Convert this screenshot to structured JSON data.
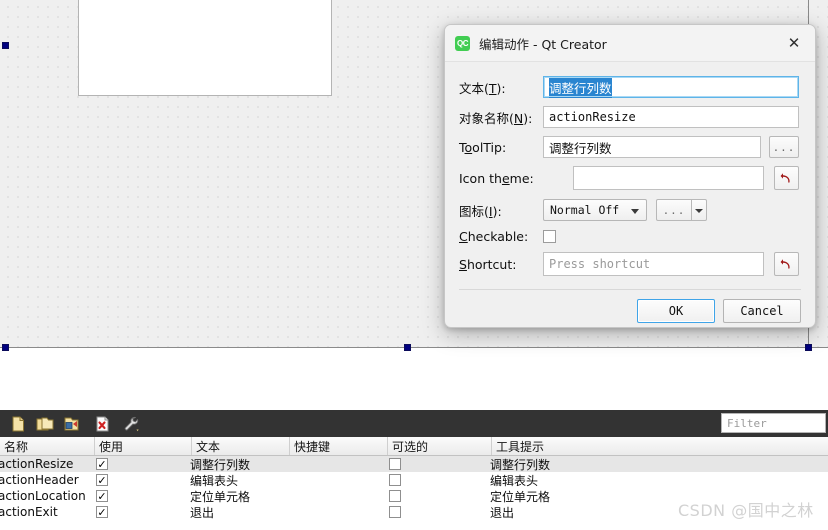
{
  "designer": {
    "widget_name": "form-widget",
    "selection_handles": 7
  },
  "dialog": {
    "title": "编辑动作 - Qt Creator",
    "app_icon_label": "QC",
    "close_label": "✕",
    "fields": {
      "text": {
        "label_prefix": "文本(",
        "label_mnemonic": "T",
        "label_suffix": "):",
        "value": "调整行列数"
      },
      "object_name": {
        "label_prefix": "对象名称(",
        "label_mnemonic": "N",
        "label_suffix": "):",
        "value": "actionResize"
      },
      "tooltip": {
        "label_pre": "T",
        "label_mnemonic": "o",
        "label_post": "olTip:",
        "value": "调整行列数",
        "browse_label": "..."
      },
      "icon_theme": {
        "label_pre": "Icon th",
        "label_mnemonic": "e",
        "label_post": "me:",
        "value": "",
        "revert_title": "revert"
      },
      "icon": {
        "label_prefix": "图标(",
        "label_mnemonic": "I",
        "label_suffix": "):",
        "combo_value": "Normal Off",
        "browse_label": "..."
      },
      "checkable": {
        "label_mnemonic": "C",
        "label_post": "heckable:",
        "checked": false
      },
      "shortcut": {
        "label_mnemonic": "S",
        "label_post": "hortcut:",
        "placeholder": "Press shortcut",
        "value": "",
        "revert_title": "revert"
      }
    },
    "buttons": {
      "ok": "OK",
      "cancel": "Cancel"
    }
  },
  "action_editor": {
    "toolbar_icons": [
      "new-action-icon",
      "copy-icon",
      "edit-icon",
      "delete-icon",
      "tools-icon"
    ],
    "filter": {
      "placeholder": "Filter",
      "value": ""
    },
    "columns": [
      "名称",
      "使用",
      "文本",
      "快捷键",
      "可选的",
      "工具提示"
    ],
    "rows": [
      {
        "name": "actionResize",
        "used": "✓",
        "text": "调整行列数",
        "shortcut": "",
        "checkable": "",
        "tooltip": "调整行列数",
        "selected": true
      },
      {
        "name": "actionHeader",
        "used": "✓",
        "text": "编辑表头",
        "shortcut": "",
        "checkable": "",
        "tooltip": "编辑表头",
        "selected": false
      },
      {
        "name": "actionLocation",
        "used": "✓",
        "text": "定位单元格",
        "shortcut": "",
        "checkable": "",
        "tooltip": "定位单元格",
        "selected": false
      },
      {
        "name": "actionExit",
        "used": "✓",
        "text": "退出",
        "shortcut": "",
        "checkable": "",
        "tooltip": "退出",
        "selected": false
      }
    ]
  },
  "watermark": "CSDN @国中之林",
  "colors": {
    "accent_blue": "#2a85d0",
    "focus_border": "#5fb4e8",
    "selection_handle": "#00007f",
    "toolbar_dark": "#333333",
    "qt_green": "#41cd52",
    "revert_red": "#a01818"
  }
}
